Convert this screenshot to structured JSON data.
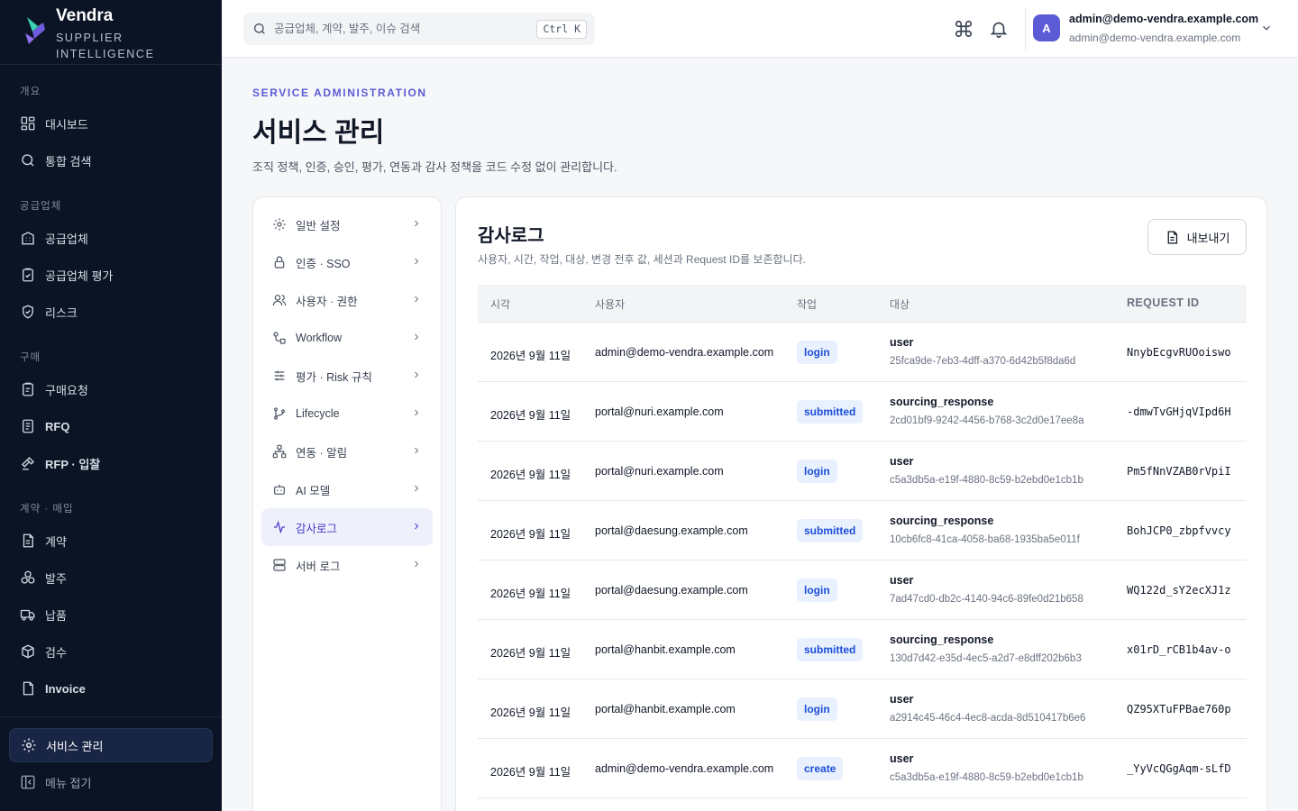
{
  "brand": {
    "name": "Vendra",
    "subtitle": "SUPPLIER INTELLIGENCE"
  },
  "sidebar": {
    "sections": [
      {
        "label": "개요"
      },
      {
        "label": "공급업체"
      },
      {
        "label": "구매"
      },
      {
        "label": "계약 · 매입"
      }
    ],
    "items": [
      {
        "label": "대시보드",
        "icon": "grid-icon"
      },
      {
        "label": "통합 검색",
        "icon": "search-icon"
      },
      {
        "label": "공급업체",
        "icon": "building-icon"
      },
      {
        "label": "공급업체 평가",
        "icon": "clipboard-check-icon"
      },
      {
        "label": "리스크",
        "icon": "shield-icon"
      },
      {
        "label": "구매요청",
        "icon": "clipboard-icon"
      },
      {
        "label": "RFQ",
        "icon": "document-icon"
      },
      {
        "label": "RFP · 입찰",
        "icon": "gavel-icon"
      },
      {
        "label": "계약",
        "icon": "file-text-icon"
      },
      {
        "label": "발주",
        "icon": "boxes-icon"
      },
      {
        "label": "납품",
        "icon": "truck-icon"
      },
      {
        "label": "검수",
        "icon": "package-check-icon"
      },
      {
        "label": "Invoice",
        "icon": "receipt-icon"
      },
      {
        "label": "서비스 관리",
        "icon": "gear-icon"
      },
      {
        "label": "메뉴 접기",
        "icon": "collapse-icon"
      }
    ]
  },
  "topbar": {
    "search_placeholder": "공급업체, 계약, 발주, 이슈 검색",
    "shortcut": "Ctrl K",
    "user": {
      "initial": "A",
      "name": "admin@demo-vendra.example.com",
      "email": "admin@demo-vendra.example.com"
    }
  },
  "header": {
    "eyebrow": "SERVICE ADMINISTRATION",
    "title": "서비스 관리",
    "description": "조직 정책, 인증, 승인, 평가, 연동과 감사 정책을 코드 수정 없이 관리합니다."
  },
  "settings_menu": [
    {
      "label": "일반 설정",
      "icon": "gear-icon"
    },
    {
      "label": "인증 · SSO",
      "icon": "lock-icon"
    },
    {
      "label": "사용자 · 권한",
      "icon": "users-icon"
    },
    {
      "label": "Workflow",
      "icon": "workflow-icon"
    },
    {
      "label": "평가 · Risk 규칙",
      "icon": "sliders-icon"
    },
    {
      "label": "Lifecycle",
      "icon": "git-branch-icon"
    },
    {
      "label": "연동 · 알림",
      "icon": "network-icon"
    },
    {
      "label": "AI 모델",
      "icon": "bot-icon"
    },
    {
      "label": "감사로그",
      "icon": "activity-icon"
    },
    {
      "label": "서버 로그",
      "icon": "server-icon"
    }
  ],
  "audit": {
    "title": "감사로그",
    "description": "사용자, 시간, 작업, 대상, 변경 전후 값, 세션과 Request ID를 보존합니다.",
    "export_label": "내보내기",
    "columns": {
      "time": "시각",
      "user": "사용자",
      "action": "작업",
      "target": "대상",
      "request_id": "REQUEST ID"
    },
    "rows": [
      {
        "time": "2026년 9월 11일",
        "user": "admin@demo-vendra.example.com",
        "action": "login",
        "target": "user",
        "target_id": "25fca9de-7eb3-4dff-a370-6d42b5f8da6d",
        "request_id": "NnybEcgvRUOoiswo"
      },
      {
        "time": "2026년 9월 11일",
        "user": "portal@nuri.example.com",
        "action": "submitted",
        "target": "sourcing_response",
        "target_id": "2cd01bf9-9242-4456-b768-3c2d0e17ee8a",
        "request_id": "-dmwTvGHjqVIpd6H"
      },
      {
        "time": "2026년 9월 11일",
        "user": "portal@nuri.example.com",
        "action": "login",
        "target": "user",
        "target_id": "c5a3db5a-e19f-4880-8c59-b2ebd0e1cb1b",
        "request_id": "Pm5fNnVZAB0rVpiI"
      },
      {
        "time": "2026년 9월 11일",
        "user": "portal@daesung.example.com",
        "action": "submitted",
        "target": "sourcing_response",
        "target_id": "10cb6fc8-41ca-4058-ba68-1935ba5e011f",
        "request_id": "BohJCP0_zbpfvvcy"
      },
      {
        "time": "2026년 9월 11일",
        "user": "portal@daesung.example.com",
        "action": "login",
        "target": "user",
        "target_id": "7ad47cd0-db2c-4140-94c6-89fe0d21b658",
        "request_id": "WQ122d_sY2ecXJ1z"
      },
      {
        "time": "2026년 9월 11일",
        "user": "portal@hanbit.example.com",
        "action": "submitted",
        "target": "sourcing_response",
        "target_id": "130d7d42-e35d-4ec5-a2d7-e8dff202b6b3",
        "request_id": "x01rD_rCB1b4av-o"
      },
      {
        "time": "2026년 9월 11일",
        "user": "portal@hanbit.example.com",
        "action": "login",
        "target": "user",
        "target_id": "a2914c45-46c4-4ec8-acda-8d510417b6e6",
        "request_id": "QZ95XTuFPBae760p"
      },
      {
        "time": "2026년 9월 11일",
        "user": "admin@demo-vendra.example.com",
        "action": "create",
        "target": "user",
        "target_id": "c5a3db5a-e19f-4880-8c59-b2ebd0e1cb1b",
        "request_id": "_YyVcQGgAqm-sLfD"
      }
    ]
  },
  "colors": {
    "sidebar_bg": "#0b1424",
    "accent": "#5b5bd6",
    "badge_bg": "#e8f1fd",
    "badge_text": "#1d4ed8"
  }
}
